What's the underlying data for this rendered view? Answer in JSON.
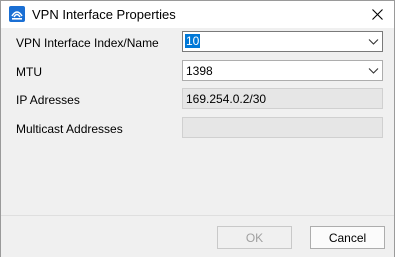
{
  "window": {
    "title": "VPN Interface Properties",
    "icon": "vpn-app-icon",
    "close_icon": "close-icon"
  },
  "form": {
    "fields": [
      {
        "label": "VPN Interface Index/Name",
        "value": "10",
        "type": "combobox",
        "focused": true
      },
      {
        "label": "MTU",
        "value": "1398",
        "type": "combobox"
      },
      {
        "label": "IP Adresses",
        "value": "169.254.0.2/30",
        "type": "readonly"
      },
      {
        "label": "Multicast Addresses",
        "value": "",
        "type": "readonly"
      }
    ]
  },
  "buttons": {
    "ok_label": "OK",
    "ok_enabled": false,
    "cancel_label": "Cancel"
  },
  "colors": {
    "accent": "#0078d7",
    "icon_blue": "#1a6fd4"
  }
}
